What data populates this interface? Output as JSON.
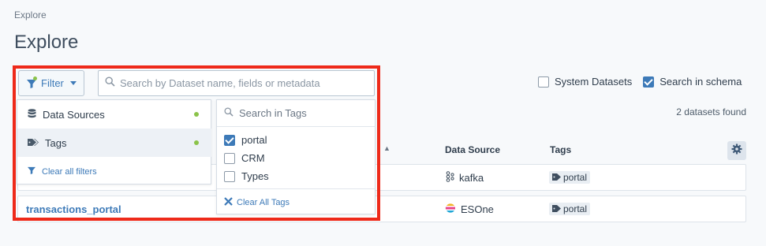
{
  "breadcrumb": "Explore",
  "page_title": "Explore",
  "toolbar": {
    "filter_label": "Filter",
    "search_placeholder": "Search by Dataset name, fields or metadata",
    "system_datasets_label": "System Datasets",
    "system_datasets_checked": false,
    "search_in_schema_label": "Search in schema",
    "search_in_schema_checked": true
  },
  "results_count": "2 datasets found",
  "table": {
    "headers": [
      "Data Source",
      "Tags"
    ],
    "rows": [
      {
        "name": "",
        "source": "kafka",
        "tag": "portal"
      },
      {
        "name": "transactions_portal",
        "source": "ESOne",
        "tag": "portal"
      }
    ]
  },
  "filter_menu": {
    "items": [
      {
        "label": "Data Sources",
        "active": true
      },
      {
        "label": "Tags",
        "active": true
      }
    ],
    "clear_label": "Clear all filters"
  },
  "tags_menu": {
    "search_placeholder": "Search in Tags",
    "options": [
      {
        "label": "portal",
        "checked": true
      },
      {
        "label": "CRM",
        "checked": false
      },
      {
        "label": "Types",
        "checked": false
      }
    ],
    "clear_label": "Clear All Tags"
  },
  "colors": {
    "accent": "#3d7ab8",
    "highlight": "#ee2a1a",
    "active_dot": "#8bc34a"
  }
}
